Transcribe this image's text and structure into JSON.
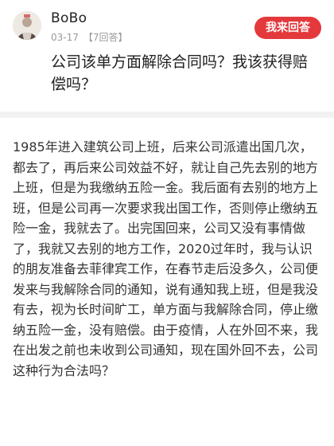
{
  "question": {
    "username": "BoBo",
    "date": "03-17",
    "answer_count": "【7回答】",
    "answer_button": "我来回答",
    "title": "公司该单方面解除合同吗？我该获得赔偿吗？",
    "body": "1985年进入建筑公司上班，后来公司派遣出国几次，都去了，再后来公司效益不好，就让自己先去别的地方上班，但是为我缴纳五险一金。我后面有去别的地方上班，但是公司再一次要求我出国工作，否则停止缴纳五险一金，我就去了。出完国回来，公司又没有事情做了，我就又去别的地方工作，2020过年时，我与认识的朋友准备去菲律宾工作，在春节走后没多久，公司便发来与我解除合同的通知，说有通知我上班，但是我没有去，视为长时间旷工，单方面与我解除合同，停止缴纳五险一金，没有赔偿。由于疫情，人在外回不来，我在出发之前也未收到公司通知，现在国外回不去，公司这种行为合法吗？"
  },
  "colors": {
    "accent": "#e4393c",
    "meta_text": "#9a9a9a",
    "divider": "#f2f2f2"
  }
}
